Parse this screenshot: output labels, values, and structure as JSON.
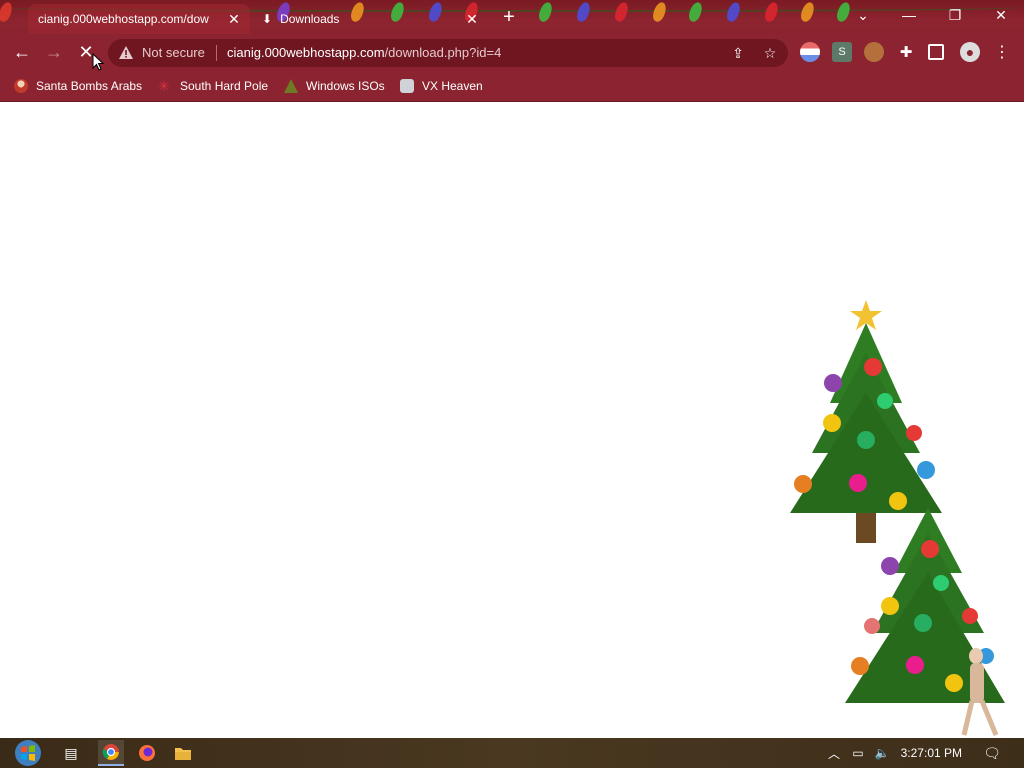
{
  "browser": {
    "tabs": [
      {
        "label": "cianig.000webhostapp.com/dow",
        "active": true
      },
      {
        "label": "Downloads",
        "active": false
      }
    ],
    "address": {
      "security_label": "Not secure",
      "host": "cianig.000webhostapp.com",
      "path": "/download.php?id=4"
    },
    "bookmarks": [
      {
        "label": "Santa Bombs Arabs",
        "icon": "santa-icon"
      },
      {
        "label": "South Hard Pole",
        "icon": "snowflake-icon"
      },
      {
        "label": "Windows ISOs",
        "icon": "tree-icon"
      },
      {
        "label": "VX Heaven",
        "icon": "vx-icon"
      }
    ],
    "extensions": [
      "flag-extension",
      "s-extension",
      "avatar-extension",
      "puzzle-icon",
      "sidepanel-icon",
      "profile-icon",
      "menu-icon"
    ],
    "theme_color": "#8b2430"
  },
  "taskbar": {
    "clock": "3:27:01 PM",
    "apps": [
      "start-button",
      "task-view-icon",
      "chrome-icon",
      "firefox-icon",
      "file-explorer-icon"
    ]
  }
}
